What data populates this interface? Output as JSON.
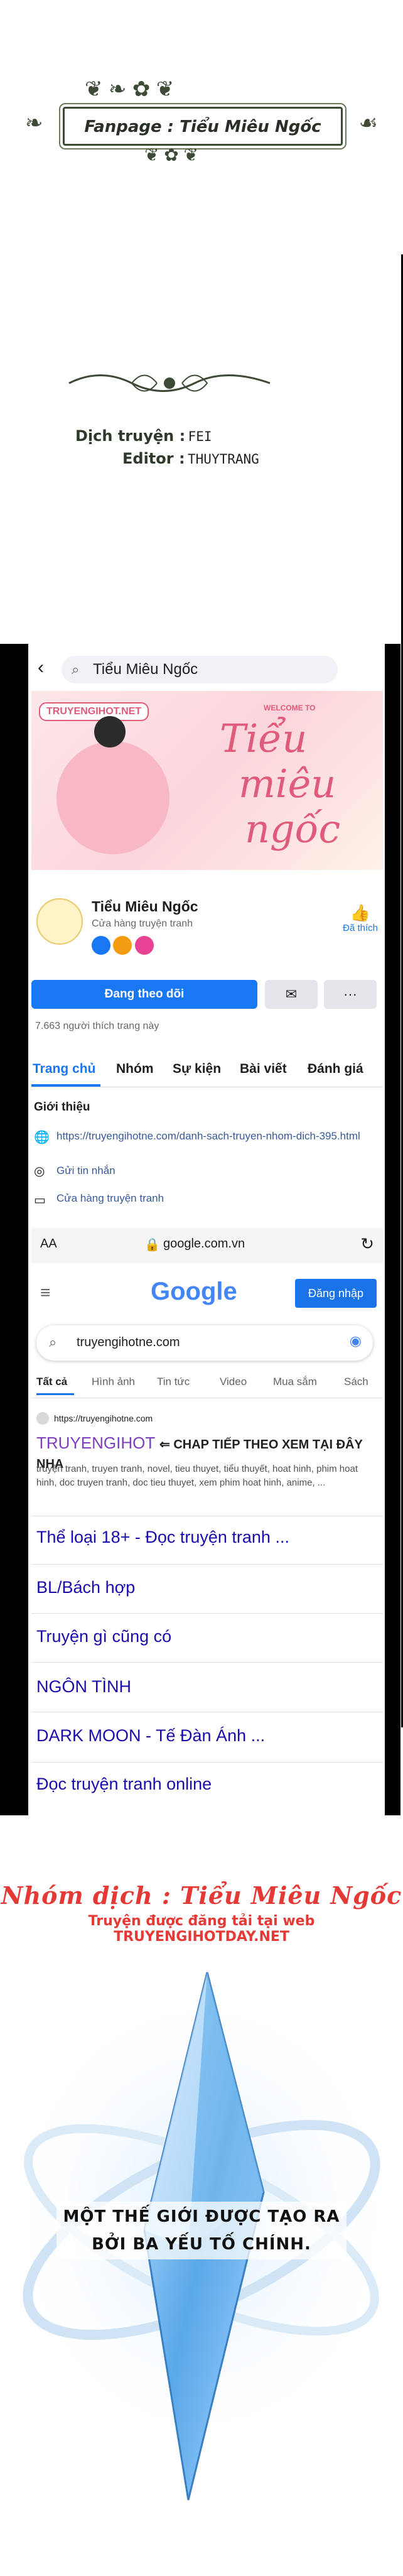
{
  "banner": {
    "text": "Fanpage : Tiểu Miêu Ngốc"
  },
  "credits": {
    "translator_label": "Dịch truyện :",
    "translator_value": "FEI",
    "editor_label": "Editor :",
    "editor_value": "THUYTRANG"
  },
  "facebook": {
    "search_text": "Tiểu Miêu Ngốc",
    "cover_badge": "TRUYENGIHOT.NET",
    "cover_welcome": "WELCOME TO",
    "cover_title_line1": "Tiểu",
    "cover_title_line2": "miêu",
    "cover_title_line3": "ngốc",
    "page_name": "Tiểu Miêu Ngốc",
    "page_category": "Cửa hàng truyện tranh",
    "like_label": "Đã thích",
    "follow_button": "Đang theo dõi",
    "likes_count": "7.663 người thích trang này",
    "tabs": [
      "Trang chủ",
      "Nhóm",
      "Sự kiện",
      "Bài viết",
      "Đánh giá"
    ],
    "intro_heading": "Giới thiệu",
    "intro_link": "https://truyengihotne.com/danh-sach-truyen-nhom-dich-395.html",
    "intro_message": "Gửi tin nhắn",
    "intro_shop": "Cửa hàng truyện tranh"
  },
  "browser": {
    "font_size": "AA",
    "url": "google.com.vn"
  },
  "google": {
    "logo": "Google",
    "signin": "Đăng nhập",
    "query": "truyengihotne.com",
    "tabs": [
      "Tất cả",
      "Hình ảnh",
      "Tin tức",
      "Video",
      "Mua sắm",
      "Sách"
    ],
    "result_url": "https://truyengihotne.com",
    "result_title_brand": "TRUYENGIHOT",
    "result_title_rest": "⇐ CHAP TIẾP THEO XEM TẠI ĐÂY NHA",
    "result_snippet": "truyện tranh, truyen tranh, novel, tieu thuyet, tiểu thuyết, hoat hinh, phim hoat hinh, doc truyen tranh, doc tieu thuyet, xem phim hoat hinh, anime, ...",
    "links": [
      "Thể loại 18+ - Đọc truyện tranh ...",
      "BL/Bách hợp",
      "Truyện gì cũng có",
      "NGÔN TÌNH",
      "DARK MOON - Tế Đàn Ánh ...",
      "Đọc truyện tranh online"
    ]
  },
  "group": {
    "title": "Nhóm dịch : Tiểu Miêu Ngốc",
    "subtitle": "Truyện được đăng tải tại web TRUYENGIHOTDAY.NET"
  },
  "quote": {
    "line1": "MỘT THẾ GIỚI ĐƯỢC TẠO RA",
    "line2": "BỞI BA YẾU TỐ CHÍNH."
  },
  "colors": {
    "fb_blue": "#1877f2",
    "google_red": "#e53935",
    "link_blue": "#1a0dab"
  }
}
